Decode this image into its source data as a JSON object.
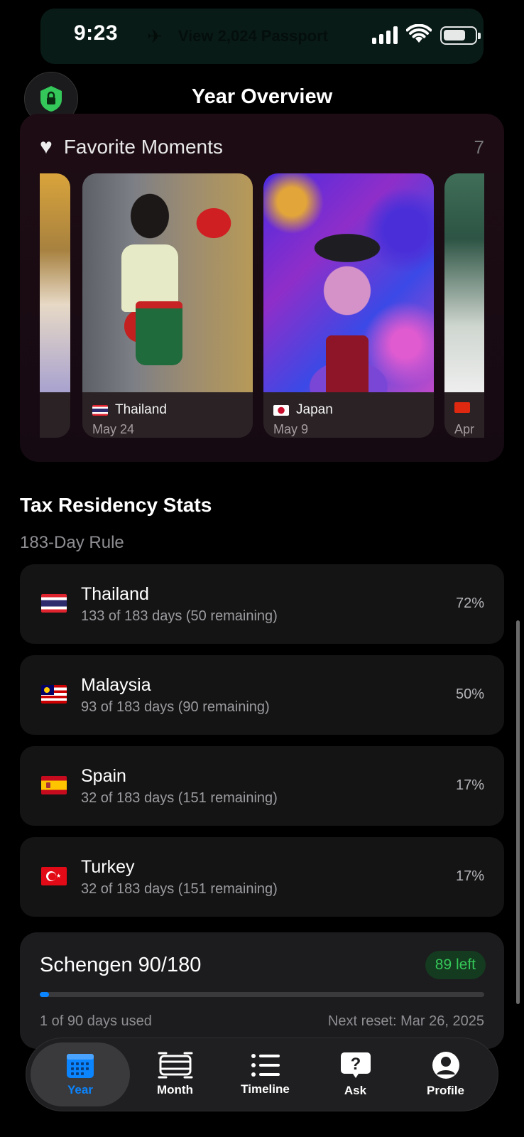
{
  "status_bar": {
    "time": "9:23",
    "banner_text": "View 2,024 Passport"
  },
  "header": {
    "title": "Year Overview"
  },
  "favorites": {
    "title": "Favorite Moments",
    "count": "7",
    "moments": [
      {
        "country": "Thailand",
        "date": "May 24",
        "flag": "thailand"
      },
      {
        "country": "Japan",
        "date": "May 9",
        "flag": "japan"
      },
      {
        "country": "",
        "date": "Apr",
        "flag": "hong-kong"
      }
    ]
  },
  "tax": {
    "title": "Tax Residency Stats",
    "subtitle": "183-Day Rule",
    "countries": [
      {
        "name": "Thailand",
        "detail": "133 of 183 days (50 remaining)",
        "percent": "72%",
        "flag": "thailand"
      },
      {
        "name": "Malaysia",
        "detail": "93 of 183 days (90 remaining)",
        "percent": "50%",
        "flag": "malaysia"
      },
      {
        "name": "Spain",
        "detail": "32 of 183 days (151 remaining)",
        "percent": "17%",
        "flag": "spain"
      },
      {
        "name": "Turkey",
        "detail": "32 of 183 days (151 remaining)",
        "percent": "17%",
        "flag": "turkey"
      }
    ]
  },
  "schengen": {
    "title": "Schengen 90/180",
    "badge": "89 left",
    "days_used": 1,
    "days_total": 90,
    "used_text": "1 of 90 days used",
    "reset_text": "Next reset: Mar 26, 2025"
  },
  "tabs": [
    {
      "label": "Year",
      "icon": "calendar-grid-icon",
      "active": true
    },
    {
      "label": "Month",
      "icon": "month-icon",
      "active": false
    },
    {
      "label": "Timeline",
      "icon": "list-icon",
      "active": false
    },
    {
      "label": "Ask",
      "icon": "question-bubble-icon",
      "active": false
    },
    {
      "label": "Profile",
      "icon": "person-circle-icon",
      "active": false
    }
  ],
  "colors": {
    "accent": "#0a84ff",
    "success": "#35c759",
    "lock": "#34c759"
  }
}
